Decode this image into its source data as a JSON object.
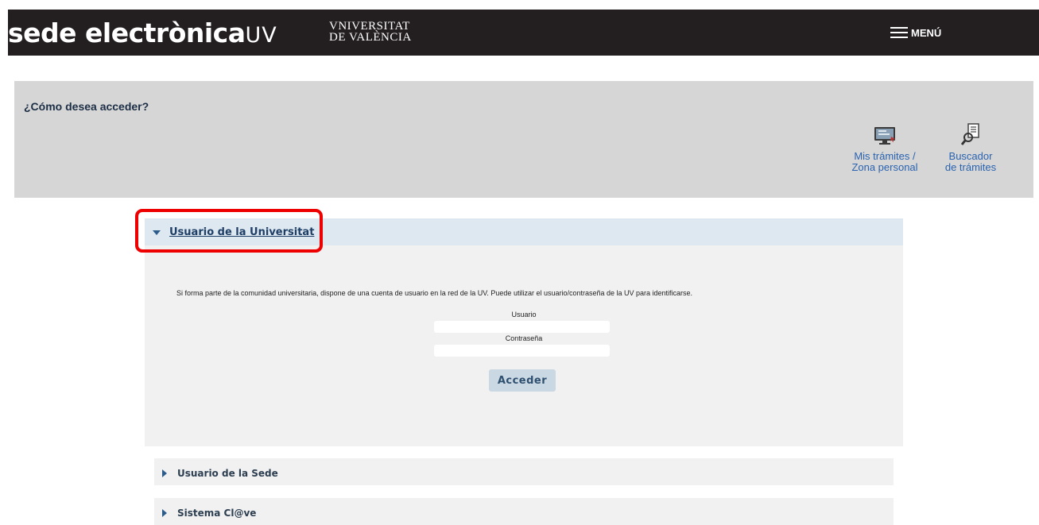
{
  "header": {
    "logo_main": "sede electrònica",
    "logo_suffix": "UV",
    "university_line1": "VNIVERSITAT",
    "university_line2": "DE VALÈNCIA",
    "menu_label": "MENÚ"
  },
  "access": {
    "title": "¿Cómo desea acceder?",
    "quick_links": [
      {
        "line1": "Mis trámites /",
        "line2": "Zona personal",
        "icon": "computer-screen-icon"
      },
      {
        "line1": "Buscador",
        "line2": "de trámites",
        "icon": "document-search-icon"
      }
    ]
  },
  "accordion": {
    "universitat": {
      "label": "Usuario de la Universitat",
      "expanded": true,
      "description": "Si forma parte de la comunidad universitaria, dispone de una cuenta de usuario en la red de la UV. Puede utilizar el usuario/contraseña de la UV para identificarse.",
      "user_label": "Usuario",
      "user_value": "",
      "password_label": "Contraseña",
      "password_value": "",
      "submit_label": "Acceder"
    },
    "sede": {
      "label": "Usuario de la Sede",
      "expanded": false
    },
    "clave": {
      "label": "Sistema Cl@ve",
      "expanded": false
    }
  },
  "colors": {
    "header_bg": "#231f20",
    "panel_bg": "#d6d6d6",
    "link_blue": "#2a63b0",
    "highlight_red": "#ee0000"
  }
}
